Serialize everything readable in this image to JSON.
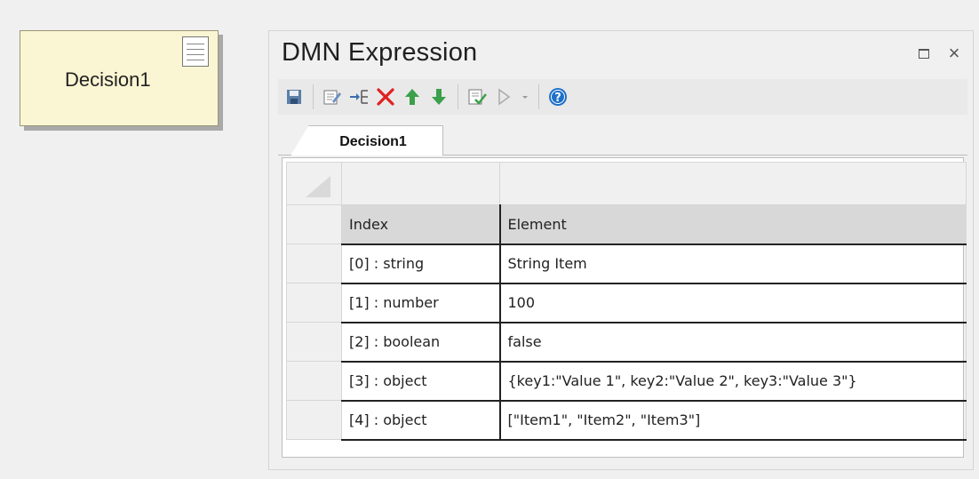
{
  "decision": {
    "label": "Decision1"
  },
  "panel": {
    "title": "DMN Expression",
    "tab": "Decision1",
    "table": {
      "headers": [
        "Index",
        "Element"
      ],
      "rows": [
        [
          "[0] : string",
          "String Item"
        ],
        [
          "[1] : number",
          "100"
        ],
        [
          "[2] : boolean",
          "false"
        ],
        [
          "[3] : object",
          "{key1:\"Value 1\", key2:\"Value 2\", key3:\"Value 3\"}"
        ],
        [
          "[4] : object",
          "[\"Item1\", \"Item2\", \"Item3\"]"
        ]
      ]
    }
  },
  "toolbar": {
    "icons": [
      "save-icon",
      "edit-icon",
      "insert-icon",
      "delete-icon",
      "move-up-icon",
      "move-down-icon",
      "validate-icon",
      "run-icon",
      "dropdown-icon",
      "help-icon"
    ]
  },
  "colors": {
    "decision_fill": "#faf5d2",
    "delete_red": "#e02020",
    "arrow_green": "#3aa04a",
    "help_blue": "#1e6fc8"
  }
}
